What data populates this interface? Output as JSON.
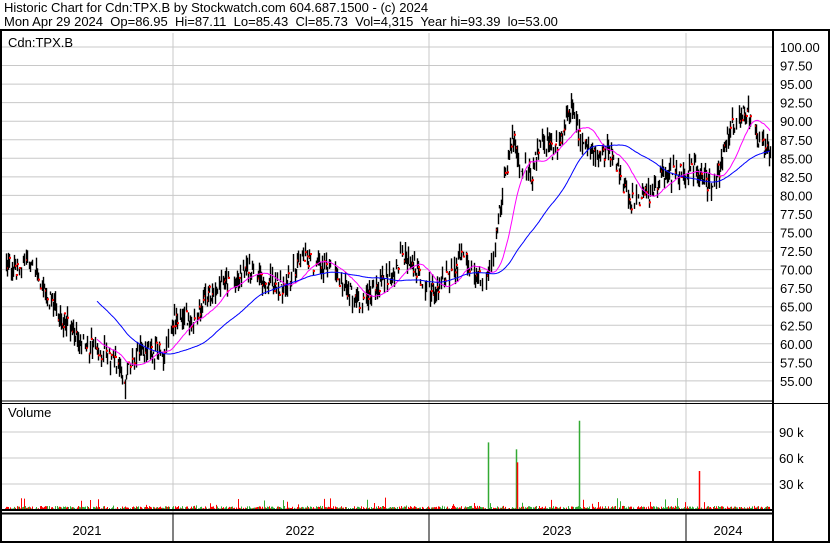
{
  "header": {
    "title": "Historic Chart for Cdn:TPX.B by Stockwatch.com 604.687.1500 - (c) 2024",
    "date": "Mon Apr 29 2024",
    "open": "Op=86.95",
    "high": "Hi=87.11",
    "low": "Lo=85.43",
    "close": "Cl=85.73",
    "volume": "Vol=4,315",
    "year_hi": "Year hi=93.39",
    "year_lo": "lo=53.00"
  },
  "colors": {
    "bars": "#000000",
    "close_tick": "#ff0000",
    "ma_short": "#ff00ff",
    "ma_long": "#0000ff",
    "vol_up": "#33aa33",
    "vol_down": "#ff0000",
    "grid": "#c8c8c8"
  },
  "chart_data": {
    "type": "line",
    "symbol_label": "Cdn:TPX.B",
    "volume_label": "Volume",
    "price_ticks": [
      "100.00",
      "97.50",
      "95.00",
      "92.50",
      "90.00",
      "87.50",
      "85.00",
      "82.50",
      "80.00",
      "77.50",
      "75.00",
      "72.50",
      "70.00",
      "67.50",
      "65.00",
      "62.50",
      "60.00",
      "57.50",
      "55.00"
    ],
    "ylim": [
      52.5,
      101.5
    ],
    "volume_ticks": [
      "90 k",
      "60 k",
      "30 k"
    ],
    "volume_tick_values": [
      90000,
      60000,
      30000
    ],
    "years": [
      "2021",
      "2022",
      "2023",
      "2024"
    ],
    "close_series_approx": [
      71,
      70,
      72,
      71,
      66.5,
      65,
      63,
      62,
      60,
      59.5,
      58.5,
      58,
      55,
      58.5,
      59,
      59,
      59,
      63,
      64,
      63,
      66,
      67,
      68,
      68,
      70,
      70,
      68.5,
      68,
      67,
      70,
      72,
      71,
      70,
      70,
      68,
      66.5,
      65,
      67,
      69,
      69,
      72.5,
      71,
      68.5,
      67,
      69,
      69,
      72,
      70,
      68,
      71,
      80,
      88,
      84,
      83,
      87.5,
      86,
      88,
      92,
      87,
      86,
      85.5,
      86,
      82,
      79,
      80,
      80,
      83,
      83,
      83,
      84,
      83,
      81,
      84,
      89,
      91,
      91,
      87,
      85.73
    ],
    "volume_typical": 3000,
    "volume_spikes": [
      {
        "period": "2023 Jan",
        "value": 78000,
        "dir": "up"
      },
      {
        "period": "2023 Feb",
        "value": 70000,
        "dir": "up"
      },
      {
        "period": "2023 Feb",
        "value": 55000,
        "dir": "down"
      },
      {
        "period": "2023 May",
        "value": 103000,
        "dir": "up"
      },
      {
        "period": "2024 Jan",
        "value": 45000,
        "dir": "down"
      }
    ],
    "series": [
      {
        "name": "Daily OHLC"
      },
      {
        "name": "Short moving average"
      },
      {
        "name": "Long moving average"
      }
    ]
  }
}
